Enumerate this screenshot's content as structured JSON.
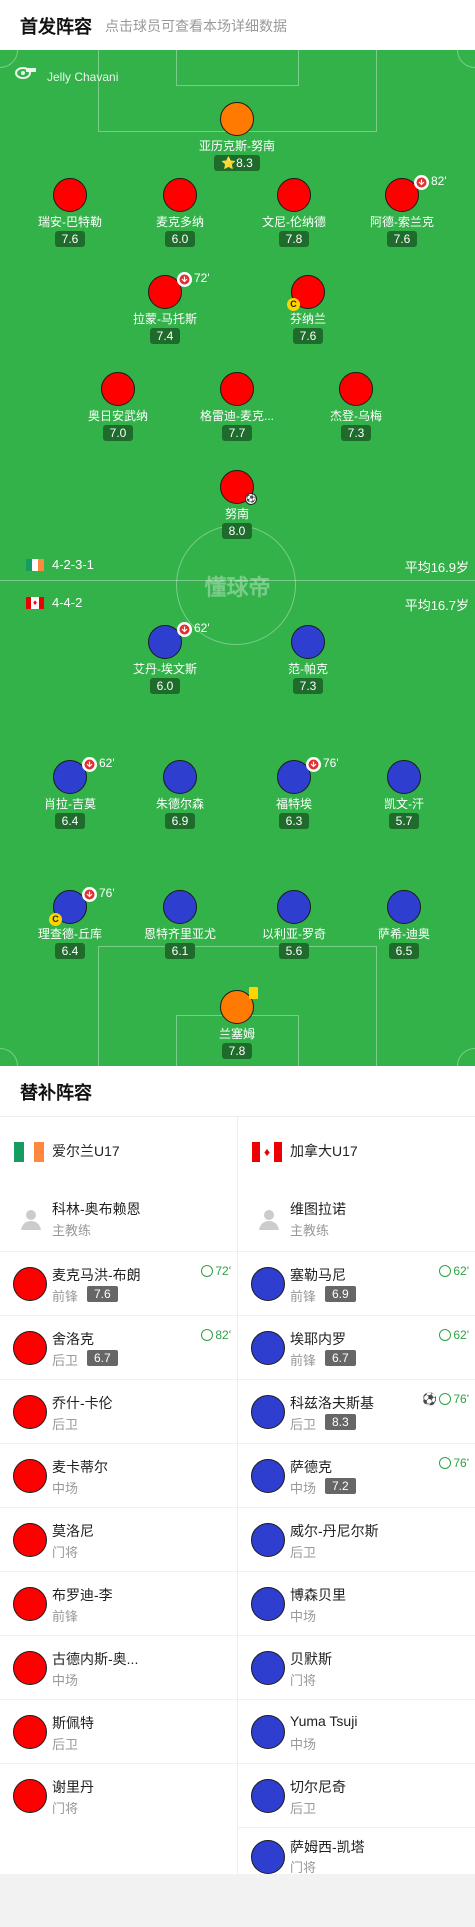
{
  "header": {
    "title": "首发阵容",
    "subtitle": "点击球员可查看本场详细数据"
  },
  "referee": {
    "name": "Jelly Chavani"
  },
  "watermark": "懂球帝",
  "teams": {
    "home": {
      "formation": "4-2-3-1",
      "avg_age": "平均16.9岁",
      "name": "爱尔兰U17",
      "color": "#ff0000"
    },
    "away": {
      "formation": "4-4-2",
      "avg_age": "平均16.7岁",
      "name": "加拿大U17",
      "color": "#2e3fd0"
    }
  },
  "home_players": [
    {
      "name": "亚历克斯-努南",
      "rating": "8.3",
      "gk": true,
      "best": true
    },
    {
      "name": "瑞安-巴特勒",
      "rating": "7.6"
    },
    {
      "name": "麦克多纳",
      "rating": "6.0"
    },
    {
      "name": "文尼-伦纳德",
      "rating": "7.8"
    },
    {
      "name": "阿德-索兰克",
      "rating": "7.6",
      "sub_out": "82'"
    },
    {
      "name": "拉蒙-马托斯",
      "rating": "7.4",
      "sub_out": "72'"
    },
    {
      "name": "芬纳兰",
      "rating": "7.6",
      "captain": true
    },
    {
      "name": "奥日安武纳",
      "rating": "7.0"
    },
    {
      "name": "格雷迪-麦克...",
      "rating": "7.7"
    },
    {
      "name": "杰登-乌梅",
      "rating": "7.3"
    },
    {
      "name": "努南",
      "rating": "8.0",
      "goal": true
    }
  ],
  "away_players": [
    {
      "name": "艾丹-埃文斯",
      "rating": "6.0",
      "sub_out": "62'"
    },
    {
      "name": "范-帕克",
      "rating": "7.3"
    },
    {
      "name": "肖拉-吉莫",
      "rating": "6.4",
      "sub_out": "62'"
    },
    {
      "name": "朱德尔森",
      "rating": "6.9"
    },
    {
      "name": "福特埃",
      "rating": "6.3",
      "sub_out": "76'"
    },
    {
      "name": "凯文-汗",
      "rating": "5.7"
    },
    {
      "name": "理查德-丘库",
      "rating": "6.4",
      "sub_out": "76'",
      "captain": true
    },
    {
      "name": "恩特齐里亚尤",
      "rating": "6.1"
    },
    {
      "name": "以利亚-罗奇",
      "rating": "5.6"
    },
    {
      "name": "萨希-迪奥",
      "rating": "6.5"
    },
    {
      "name": "兰塞姆",
      "rating": "7.8",
      "gk": true,
      "yellow_card": true
    }
  ],
  "subs": {
    "title": "替补阵容",
    "coach_role": "主教练",
    "home_coach": "科林-奥布赖恩",
    "away_coach": "维图拉诺",
    "home": [
      {
        "name": "麦克马洪-布朗",
        "pos": "前锋",
        "rating": "7.6",
        "in": "72'"
      },
      {
        "name": "舍洛克",
        "pos": "后卫",
        "rating": "6.7",
        "in": "82'"
      },
      {
        "name": "乔什-卡伦",
        "pos": "后卫"
      },
      {
        "name": "麦卡蒂尔",
        "pos": "中场"
      },
      {
        "name": "莫洛尼",
        "pos": "门将"
      },
      {
        "name": "布罗迪-李",
        "pos": "前锋"
      },
      {
        "name": "古德内斯-奥...",
        "pos": "中场"
      },
      {
        "name": "斯佩特",
        "pos": "后卫"
      },
      {
        "name": "谢里丹",
        "pos": "门将"
      }
    ],
    "away": [
      {
        "name": "塞勒马尼",
        "pos": "前锋",
        "rating": "6.9",
        "in": "62'"
      },
      {
        "name": "埃耶内罗",
        "pos": "前锋",
        "rating": "6.7",
        "in": "62'"
      },
      {
        "name": "科兹洛夫斯基",
        "pos": "后卫",
        "rating": "8.3",
        "in": "76'",
        "goal": true
      },
      {
        "name": "萨德克",
        "pos": "中场",
        "rating": "7.2",
        "in": "76'"
      },
      {
        "name": "威尔-丹尼尔斯",
        "pos": "后卫"
      },
      {
        "name": "博森贝里",
        "pos": "中场"
      },
      {
        "name": "贝默斯",
        "pos": "门将"
      },
      {
        "name": "Yuma Tsuji",
        "pos": "中场"
      },
      {
        "name": "切尔尼奇",
        "pos": "后卫"
      },
      {
        "name": "萨姆西-凯塔",
        "pos": "门将"
      }
    ]
  }
}
